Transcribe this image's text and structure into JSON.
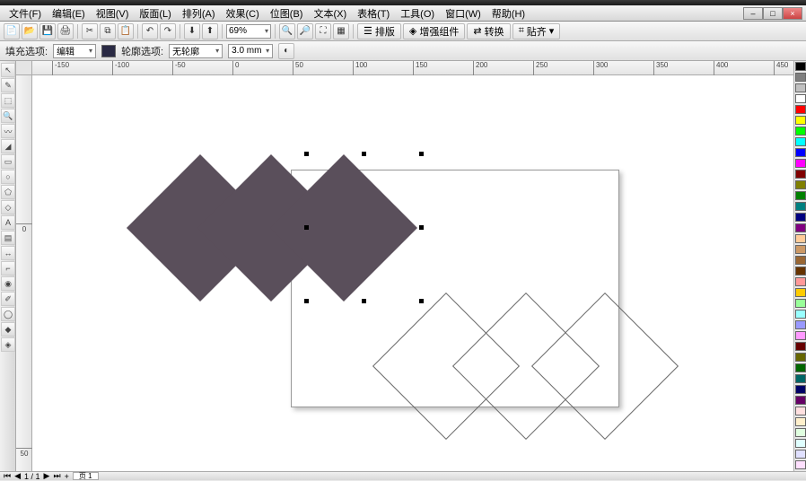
{
  "menu": {
    "file": "文件(F)",
    "edit": "编辑(E)",
    "view": "视图(V)",
    "layout": "版面(L)",
    "arrange": "排列(A)",
    "effects": "效果(C)",
    "bitmaps": "位图(B)",
    "text": "文本(X)",
    "table": "表格(T)",
    "tools": "工具(O)",
    "window": "窗口(W)",
    "help": "帮助(H)"
  },
  "toolbar1": {
    "zoom": "69%",
    "btn_paibian": "排版",
    "btn_zengqiang": "增强组件",
    "btn_zhuanhuan": "转换",
    "btn_tiezhi": "贴齐"
  },
  "toolbar2": {
    "fill_label": "填充选项:",
    "fill_value": "编辑",
    "outline_label": "轮廓选项:",
    "outline_value": "无轮廓",
    "width_value": "3.0 mm"
  },
  "ruler_h": [
    "-150",
    "-100",
    "-50",
    "0",
    "50",
    "100",
    "150",
    "200",
    "250",
    "300",
    "350",
    "400",
    "450"
  ],
  "ruler_v": [
    "0",
    "50"
  ],
  "shapes": {
    "fill_color": "#5a4f5b"
  },
  "bottombar": {
    "page": "页 1",
    "page_count": "1 / 1"
  },
  "palette_colors": [
    "#000000",
    "#7f7f7f",
    "#c0c0c0",
    "#ffffff",
    "#ff0000",
    "#ffff00",
    "#00ff00",
    "#00ffff",
    "#0000ff",
    "#ff00ff",
    "#800000",
    "#808000",
    "#008000",
    "#008080",
    "#000080",
    "#800080",
    "#ffcc99",
    "#cc9966",
    "#996633",
    "#663300",
    "#ff9999",
    "#ffcc00",
    "#99ff99",
    "#99ffff",
    "#9999ff",
    "#ff99ff",
    "#660000",
    "#666600",
    "#006600",
    "#006666",
    "#000066",
    "#660066",
    "#ffe0e0",
    "#fff0cc",
    "#e0ffe0",
    "#e0ffff",
    "#e0e0ff",
    "#ffe0ff",
    "#330000",
    "#333300",
    "#003300"
  ]
}
